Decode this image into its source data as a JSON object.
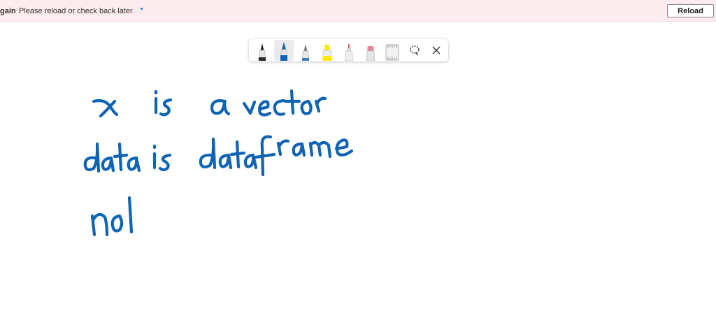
{
  "banner": {
    "title": "gain",
    "message": "Please reload or check back later.",
    "reload_label": "Reload"
  },
  "toolbar": {
    "tools": [
      {
        "name": "ballpoint-pen",
        "color": "#2b2b2b"
      },
      {
        "name": "pen",
        "color": "#1064b5",
        "selected": true
      },
      {
        "name": "pencil",
        "color": "#3a7fc4"
      },
      {
        "name": "highlighter",
        "color": "#ffe80a"
      },
      {
        "name": "eraser-tip",
        "color": "#e05a5a"
      },
      {
        "name": "eraser",
        "color": "#e88a9a"
      },
      {
        "name": "ruler",
        "color": "#bdbdbd"
      },
      {
        "name": "lasso-select-icon"
      },
      {
        "name": "close-icon"
      }
    ]
  },
  "colors": {
    "ink": "#1064b5",
    "banner_background": "#fdecef",
    "banner_dot": "#1a73e8"
  }
}
